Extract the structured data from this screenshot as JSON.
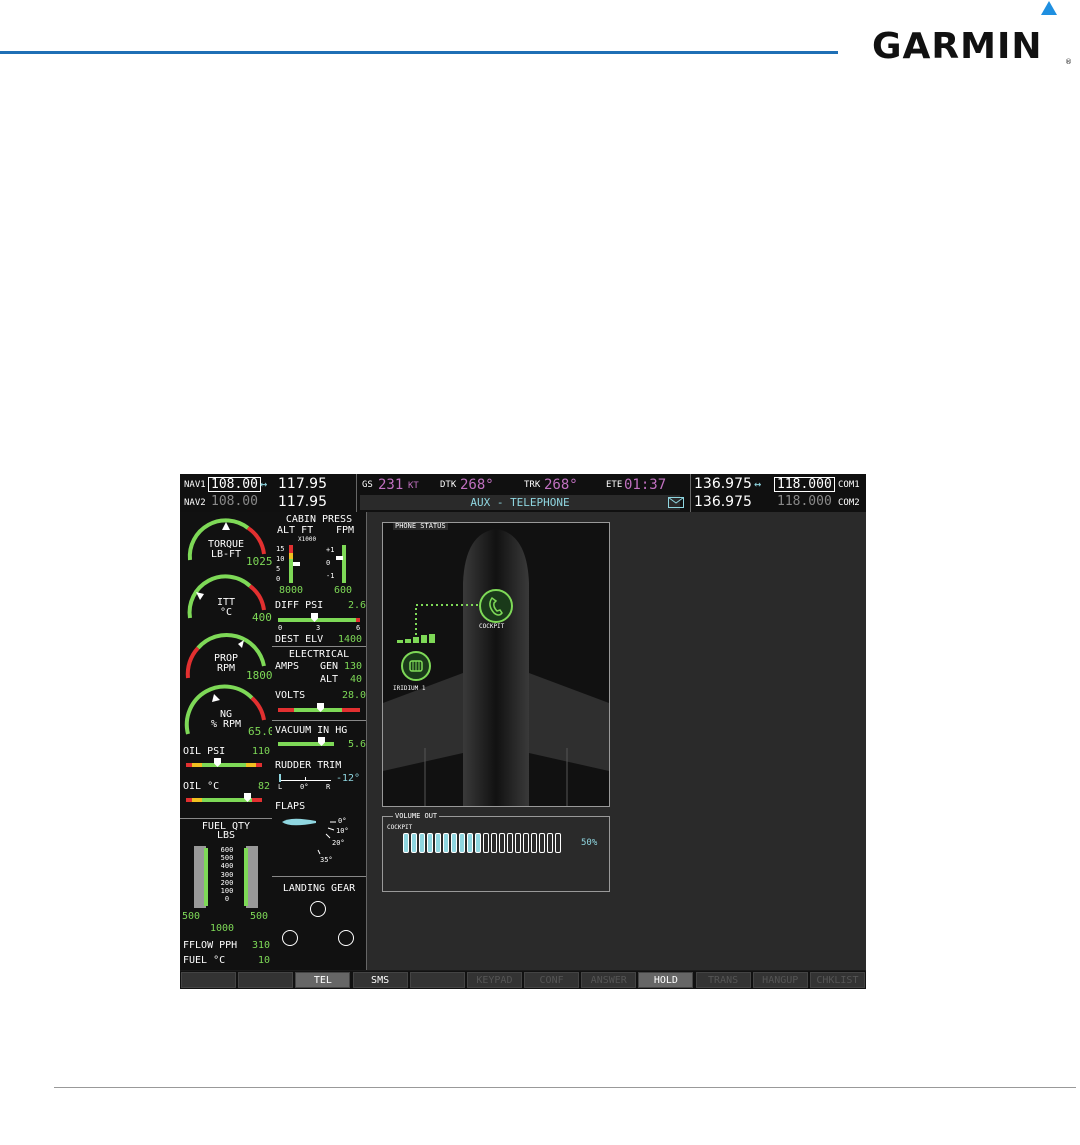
{
  "brand": {
    "name": "GARMIN",
    "reg": "®"
  },
  "nav": {
    "nav1_label": "NAV1",
    "nav1_active": "108.00",
    "nav1_standby": "117.95",
    "nav2_label": "NAV2",
    "nav2_active": "108.00",
    "nav2_standby": "117.95",
    "swap_glyph": "↔"
  },
  "fields": {
    "gs_label": "GS",
    "gs_value": "231",
    "gs_unit": "KT",
    "dtk_label": "DTK",
    "dtk_value": "268°",
    "trk_label": "TRK",
    "trk_value": "268°",
    "ete_label": "ETE",
    "ete_value": "01:37",
    "page_title": "AUX - TELEPHONE"
  },
  "com": {
    "com1_standby": "136.975",
    "com1_active": "118.000",
    "com1_label": "COM1",
    "com2_standby": "136.975",
    "com2_active": "118.000",
    "com2_label": "COM2",
    "swap_glyph": "↔"
  },
  "engine": {
    "torque_label": "TORQUE\nLB-FT",
    "torque_value": "1025",
    "itt_label": "ITT\n°C",
    "itt_value": "400",
    "prop_label": "PROP\nRPM",
    "prop_value": "1800",
    "ng_label": "NG\n% RPM",
    "ng_value": "65.0",
    "oil_psi_label": "OIL PSI",
    "oil_psi_value": "110",
    "oil_c_label": "OIL °C",
    "oil_c_value": "82",
    "fuel_qty_title": "FUEL QTY",
    "fuel_qty_unit": "LBS",
    "fuel_scale": [
      "600",
      "500",
      "400",
      "300",
      "200",
      "100",
      "0"
    ],
    "fuel_left": "500",
    "fuel_right": "500",
    "fuel_total": "1000",
    "fflow_label": "FFLOW PPH",
    "fflow_value": "310",
    "fuel_c_label": "FUEL °C",
    "fuel_c_value": "10"
  },
  "systems": {
    "cabin_title": "CABIN PRESS",
    "alt_ft": "ALT FT",
    "fpm": "FPM",
    "x1000": "X1000",
    "alt_scale": [
      "15",
      "10",
      "5",
      "0"
    ],
    "fpm_scale": [
      "+1",
      "0",
      "-1"
    ],
    "alt_value": "8000",
    "fpm_value": "600",
    "diff_label": "DIFF PSI",
    "diff_value": "2.6",
    "diff_scale": [
      "0",
      "3",
      "6"
    ],
    "dest_label": "DEST ELV",
    "dest_value": "1400",
    "elec_title": "ELECTRICAL",
    "amps_label": "AMPS",
    "gen_label": "GEN",
    "gen_value": "130",
    "alt_label": "ALT",
    "alt_amps_value": "40",
    "volts_label": "VOLTS",
    "volts_value": "28.0",
    "vac_label": "VACUUM IN HG",
    "vac_value": "5.6",
    "rudder_label": "RUDDER TRIM",
    "rudder_value": "-12°",
    "rudder_scale": [
      "L",
      "0°",
      "R"
    ],
    "flaps_label": "FLAPS",
    "flaps_scale": [
      "0°",
      "10°",
      "20°",
      "35°"
    ],
    "gear_label": "LANDING GEAR"
  },
  "telephone": {
    "phone_status_title": "PHONE STATUS",
    "cockpit_label": "COCKPIT",
    "iridium_label": "IRIDIUM 1",
    "volume_title": "VOLUME OUT",
    "volume_channel": "COCKPIT",
    "volume_percent": "50%",
    "volume_fraction": 0.5
  },
  "softkeys": [
    "",
    "",
    "TEL",
    "SMS",
    "",
    "KEYPAD",
    "CONF",
    "ANSWER",
    "HOLD",
    "TRANS",
    "HANGUP",
    "CHKLIST"
  ],
  "colors": {
    "accent": "#1f6fb5",
    "green": "#7ed957",
    "magenta": "#c070c0",
    "cyan": "#8fd6e0",
    "red": "#e23030",
    "yellow": "#f0c020"
  }
}
